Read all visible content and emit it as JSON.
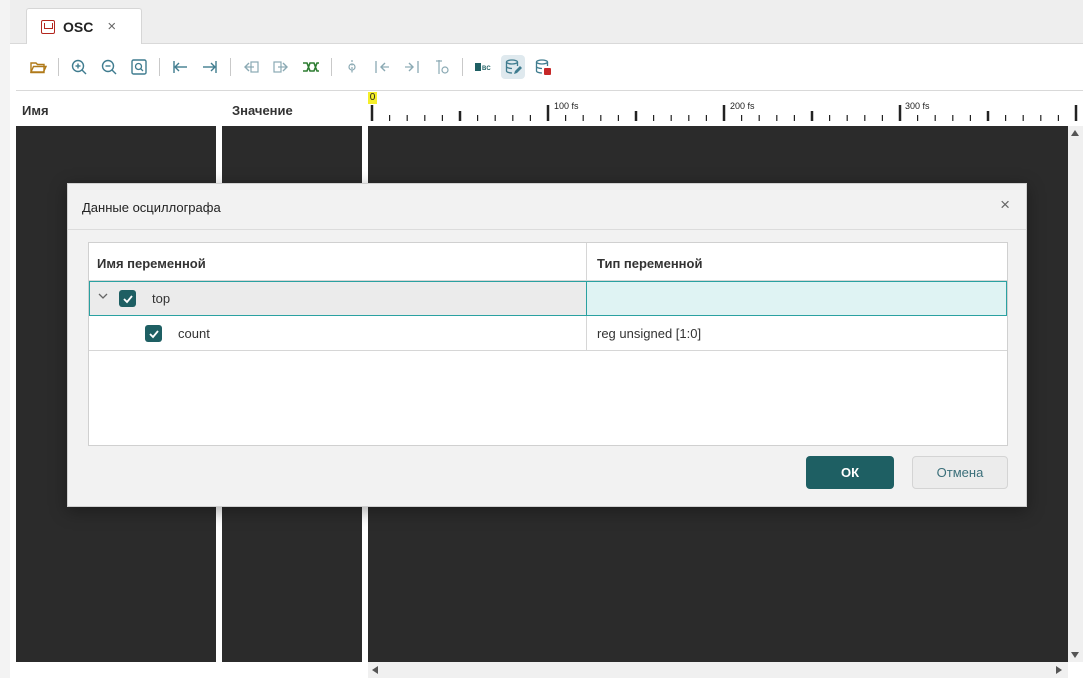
{
  "tab": {
    "label": "OSC",
    "close": "×",
    "icon": "waveform-file-icon"
  },
  "toolbar": {
    "items": [
      "open-folder-icon",
      "zoom-in-icon",
      "zoom-out-icon",
      "zoom-fit-icon",
      "go-start-icon",
      "go-end-icon",
      "prev-edge-icon",
      "next-edge-icon",
      "bus-icon",
      "add-marker-icon",
      "prev-marker-icon",
      "next-marker-icon",
      "marker-settings-icon",
      "text-format-icon",
      "database-edit-icon",
      "database-export-icon"
    ],
    "active": "database-edit-icon"
  },
  "columns": {
    "name": "Имя",
    "value": "Значение"
  },
  "ruler": {
    "cursor_label": "0",
    "labels": [
      "100 fs",
      "200 fs",
      "300 fs"
    ]
  },
  "dialog": {
    "title": "Данные осциллографа",
    "close": "×",
    "headers": {
      "var_name": "Имя переменной",
      "var_type": "Тип переменной"
    },
    "rows": [
      {
        "name": "top",
        "type": "",
        "checked": true,
        "expanded": true
      },
      {
        "name": "count",
        "type": "reg unsigned [1:0]",
        "checked": true
      }
    ],
    "ok": "ОК",
    "cancel": "Отмена"
  },
  "colors": {
    "accent": "#1e5f63",
    "panel_bg": "#2b2b2b",
    "selection": "#dff3f3",
    "selection_border": "#2aa1a1"
  }
}
